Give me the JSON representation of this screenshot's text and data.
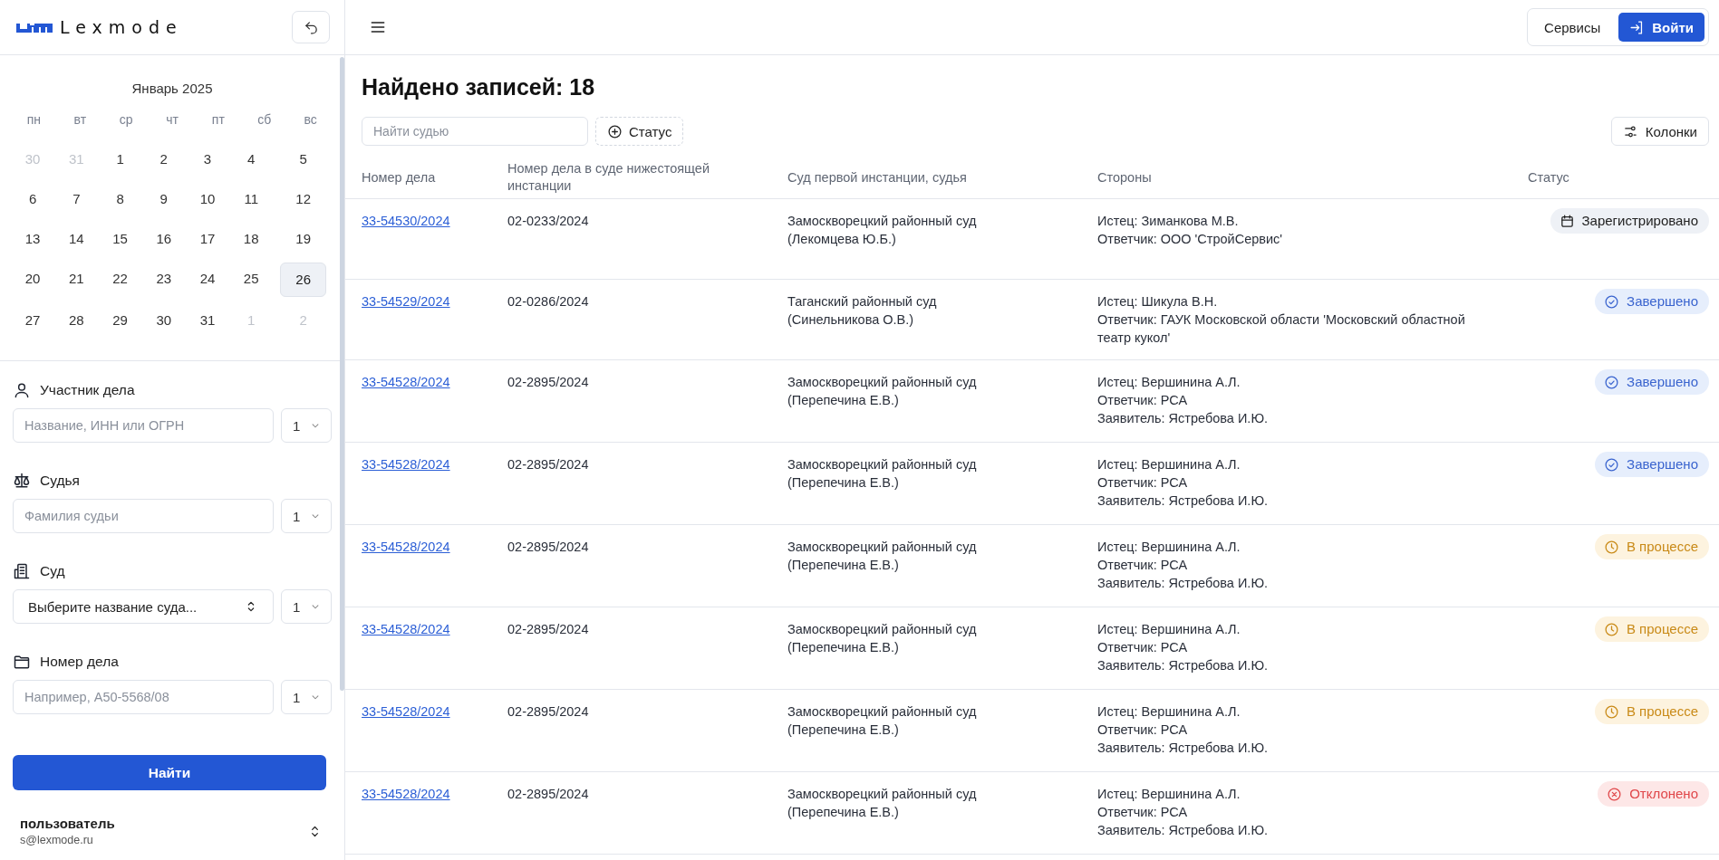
{
  "logo": {
    "text": "Lexmode"
  },
  "calendar": {
    "title": "Январь 2025",
    "weekdays": [
      "пн",
      "вт",
      "ср",
      "чт",
      "пт",
      "сб",
      "вс"
    ],
    "days": [
      {
        "label": "30",
        "other_month": true,
        "selected": false
      },
      {
        "label": "31",
        "other_month": true,
        "selected": false
      },
      {
        "label": "1",
        "other_month": false,
        "selected": false
      },
      {
        "label": "2",
        "other_month": false,
        "selected": false
      },
      {
        "label": "3",
        "other_month": false,
        "selected": false
      },
      {
        "label": "4",
        "other_month": false,
        "selected": false
      },
      {
        "label": "5",
        "other_month": false,
        "selected": false
      },
      {
        "label": "6",
        "other_month": false,
        "selected": false
      },
      {
        "label": "7",
        "other_month": false,
        "selected": false
      },
      {
        "label": "8",
        "other_month": false,
        "selected": false
      },
      {
        "label": "9",
        "other_month": false,
        "selected": false
      },
      {
        "label": "10",
        "other_month": false,
        "selected": false
      },
      {
        "label": "11",
        "other_month": false,
        "selected": false
      },
      {
        "label": "12",
        "other_month": false,
        "selected": false
      },
      {
        "label": "13",
        "other_month": false,
        "selected": false
      },
      {
        "label": "14",
        "other_month": false,
        "selected": false
      },
      {
        "label": "15",
        "other_month": false,
        "selected": false
      },
      {
        "label": "16",
        "other_month": false,
        "selected": false
      },
      {
        "label": "17",
        "other_month": false,
        "selected": false
      },
      {
        "label": "18",
        "other_month": false,
        "selected": false
      },
      {
        "label": "19",
        "other_month": false,
        "selected": false
      },
      {
        "label": "20",
        "other_month": false,
        "selected": false
      },
      {
        "label": "21",
        "other_month": false,
        "selected": false
      },
      {
        "label": "22",
        "other_month": false,
        "selected": false
      },
      {
        "label": "23",
        "other_month": false,
        "selected": false
      },
      {
        "label": "24",
        "other_month": false,
        "selected": false
      },
      {
        "label": "25",
        "other_month": false,
        "selected": false
      },
      {
        "label": "26",
        "other_month": false,
        "selected": true
      },
      {
        "label": "27",
        "other_month": false,
        "selected": false
      },
      {
        "label": "28",
        "other_month": false,
        "selected": false
      },
      {
        "label": "29",
        "other_month": false,
        "selected": false
      },
      {
        "label": "30",
        "other_month": false,
        "selected": false
      },
      {
        "label": "31",
        "other_month": false,
        "selected": false
      },
      {
        "label": "1",
        "other_month": true,
        "selected": false
      },
      {
        "label": "2",
        "other_month": true,
        "selected": false
      }
    ]
  },
  "filters": [
    {
      "kind": "person",
      "label": "Участник дела",
      "field": {
        "kind": "input",
        "placeholder": "Название, ИНН или ОГРН"
      },
      "count": "1"
    },
    {
      "kind": "scales",
      "label": "Судья",
      "field": {
        "kind": "input",
        "placeholder": "Фамилия судьи"
      },
      "count": "1"
    },
    {
      "kind": "building",
      "label": "Суд",
      "field": {
        "kind": "select",
        "value": "Выберите название суда..."
      },
      "count": "1"
    },
    {
      "kind": "folder",
      "label": "Номер дела",
      "field": {
        "kind": "input",
        "placeholder": "Например, А50-5568/08"
      },
      "count": "1"
    }
  ],
  "find_button": "Найти",
  "user": {
    "name": "пользователь",
    "email": "s@lexmode.ru"
  },
  "header": {
    "services": "Сервисы",
    "login": "Войти"
  },
  "title": "Найдено записей: 18",
  "toolbar": {
    "search_placeholder": "Найти судью",
    "status_filter": "Статус",
    "columns_button": "Колонки"
  },
  "table": {
    "columns": [
      "Номер дела",
      "Номер дела в суде нижестоящей инстанции",
      "Суд первой инстанции, судья",
      "Стороны",
      "Статус"
    ],
    "rows": [
      {
        "case": "33-54530/2024",
        "lower": "02-0233/2024",
        "court": "Замоскворецкий районный суд (Лекомцева Ю.Б.)",
        "parties": [
          "Истец: Зиманкова М.В.",
          "Ответчик: ООО 'СтройСервис'"
        ],
        "status": {
          "kind": "registered",
          "text": "Зарегистрировано"
        }
      },
      {
        "case": "33-54529/2024",
        "lower": "02-0286/2024",
        "court": "Таганский районный суд (Синельникова О.В.)",
        "parties": [
          "Истец: Шикула В.Н.",
          "Ответчик: ГАУК Московской области 'Московский областной театр кукол'"
        ],
        "status": {
          "kind": "done",
          "text": "Завершено"
        }
      },
      {
        "case": "33-54528/2024",
        "lower": "02-2895/2024",
        "court": "Замоскворецкий районный суд (Перепечина Е.В.)",
        "parties": [
          "Истец: Вершинина А.Л.",
          "Ответчик: РСА",
          "Заявитель: Ястребова И.Ю."
        ],
        "status": {
          "kind": "done",
          "text": "Завершено"
        }
      },
      {
        "case": "33-54528/2024",
        "lower": "02-2895/2024",
        "court": "Замоскворецкий районный суд (Перепечина Е.В.)",
        "parties": [
          "Истец: Вершинина А.Л.",
          "Ответчик: РСА",
          "Заявитель: Ястребова И.Ю."
        ],
        "status": {
          "kind": "done",
          "text": "Завершено"
        }
      },
      {
        "case": "33-54528/2024",
        "lower": "02-2895/2024",
        "court": "Замоскворецкий районный суд (Перепечина Е.В.)",
        "parties": [
          "Истец: Вершинина А.Л.",
          "Ответчик: РСА",
          "Заявитель: Ястребова И.Ю."
        ],
        "status": {
          "kind": "progress",
          "text": "В процессе"
        }
      },
      {
        "case": "33-54528/2024",
        "lower": "02-2895/2024",
        "court": "Замоскворецкий районный суд (Перепечина Е.В.)",
        "parties": [
          "Истец: Вершинина А.Л.",
          "Ответчик: РСА",
          "Заявитель: Ястребова И.Ю."
        ],
        "status": {
          "kind": "progress",
          "text": "В процессе"
        }
      },
      {
        "case": "33-54528/2024",
        "lower": "02-2895/2024",
        "court": "Замоскворецкий районный суд (Перепечина Е.В.)",
        "parties": [
          "Истец: Вершинина А.Л.",
          "Ответчик: РСА",
          "Заявитель: Ястребова И.Ю."
        ],
        "status": {
          "kind": "progress",
          "text": "В процессе"
        }
      },
      {
        "case": "33-54528/2024",
        "lower": "02-2895/2024",
        "court": "Замоскворецкий районный суд (Перепечина Е.В.)",
        "parties": [
          "Истец: Вершинина А.Л.",
          "Ответчик: РСА",
          "Заявитель: Ястребова И.Ю."
        ],
        "status": {
          "kind": "rejected",
          "text": "Отклонено"
        }
      }
    ]
  }
}
